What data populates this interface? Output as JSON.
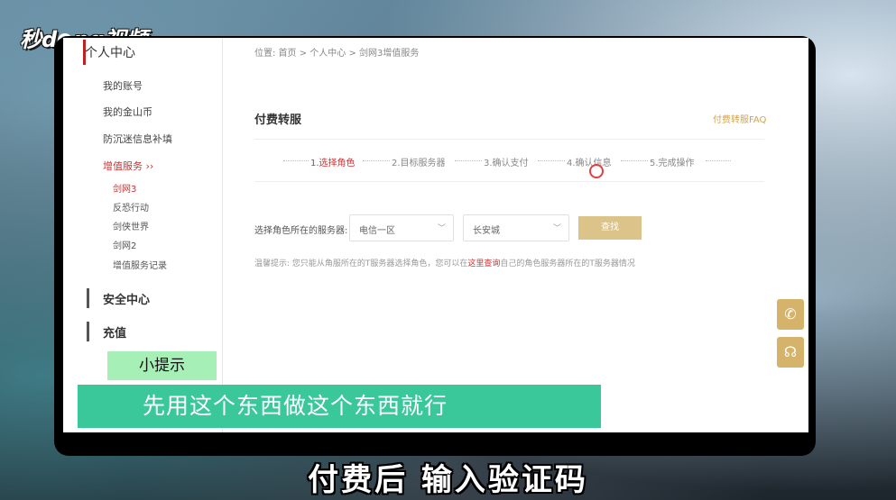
{
  "logo": {
    "text_left": "秒d",
    "text_right": "ng视频"
  },
  "sidebar": {
    "title": "个人中心",
    "items": [
      {
        "label": "我的账号"
      },
      {
        "label": "我的金山币"
      },
      {
        "label": "防沉迷信息补填"
      },
      {
        "label": "增值服务 ››"
      }
    ],
    "sub_items": [
      {
        "label": "剑网3"
      },
      {
        "label": "反恐行动"
      },
      {
        "label": "剑侠世界"
      },
      {
        "label": "剑网2"
      },
      {
        "label": "增值服务记录"
      }
    ],
    "sections": [
      {
        "label": "安全中心"
      },
      {
        "label": "充值"
      }
    ]
  },
  "breadcrumb": "位置: 首页 > 个人中心 > 剑网3增值服务",
  "page_title": "付费转服",
  "faq_link": "付费转服FAQ",
  "steps": [
    {
      "label": "1.选择角色"
    },
    {
      "label": "2.目标服务器"
    },
    {
      "label": "3.确认支付"
    },
    {
      "label": "4.确认信息"
    },
    {
      "label": "5.完成操作"
    }
  ],
  "form": {
    "label": "选择角色所在的服务器:",
    "region_select": "电信一区",
    "server_select": "长安城",
    "query_button": "查找"
  },
  "tip": {
    "prefix": "温馨提示: 您只能从角服所在的T服务器选择角色，您可以在",
    "link": "这里查询",
    "suffix": "自己的角色服务器所在的T服务器情况"
  },
  "float_buttons": {
    "phone_icon": "phone-icon",
    "support_icon": "headset-icon"
  },
  "overlay": {
    "hint_badge": "小提示",
    "banner": "先用这个东西做这个东西就行",
    "subtitle": "付费后  输入验证码"
  },
  "colors": {
    "accent_red": "#cc3333",
    "gold": "#d6b36a",
    "banner_green": "#3ac79a",
    "hint_green": "#a6efb6"
  }
}
